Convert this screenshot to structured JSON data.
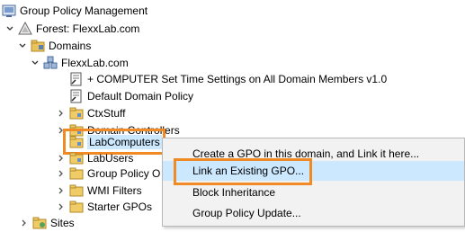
{
  "tree": {
    "root": {
      "label": "Group Policy Management",
      "icon": "gpm-console-icon"
    },
    "forest": {
      "label": "Forest: FlexxLab.com",
      "icon": "forest-icon"
    },
    "domains": {
      "label": "Domains",
      "icon": "domains-folder-icon"
    },
    "domain": {
      "label": "FlexxLab.com",
      "icon": "domain-icon"
    },
    "children": [
      {
        "label": "+ COMPUTER Set Time Settings on All Domain Members v1.0",
        "icon": "gpo-link-icon",
        "expander": false
      },
      {
        "label": "Default Domain Policy",
        "icon": "gpo-link-icon",
        "expander": false
      },
      {
        "label": "CtxStuff",
        "icon": "ou-folder-icon",
        "expander": true
      },
      {
        "label": "Domain Controllers",
        "icon": "ou-folder-icon",
        "expander": true
      },
      {
        "label": "LabComputers",
        "icon": "ou-folder-icon",
        "expander": true,
        "selected": true
      },
      {
        "label": "LabUsers",
        "icon": "ou-folder-icon",
        "expander": true
      },
      {
        "label": "Group Policy O",
        "icon": "folder-icon",
        "expander": true
      },
      {
        "label": "WMI Filters",
        "icon": "folder-icon",
        "expander": true
      },
      {
        "label": "Starter GPOs",
        "icon": "folder-icon",
        "expander": true
      }
    ],
    "sites": {
      "label": "Sites",
      "icon": "sites-icon"
    }
  },
  "context_menu": {
    "items": [
      "Create a GPO in this domain, and Link it here...",
      "Link an Existing GPO...",
      "Block Inheritance",
      "Group Policy Update..."
    ],
    "highlighted_index": 1
  },
  "colors": {
    "highlight_border": "#f08a24",
    "selection": "#cce8ff",
    "menu_bg": "#f2f2f2"
  }
}
